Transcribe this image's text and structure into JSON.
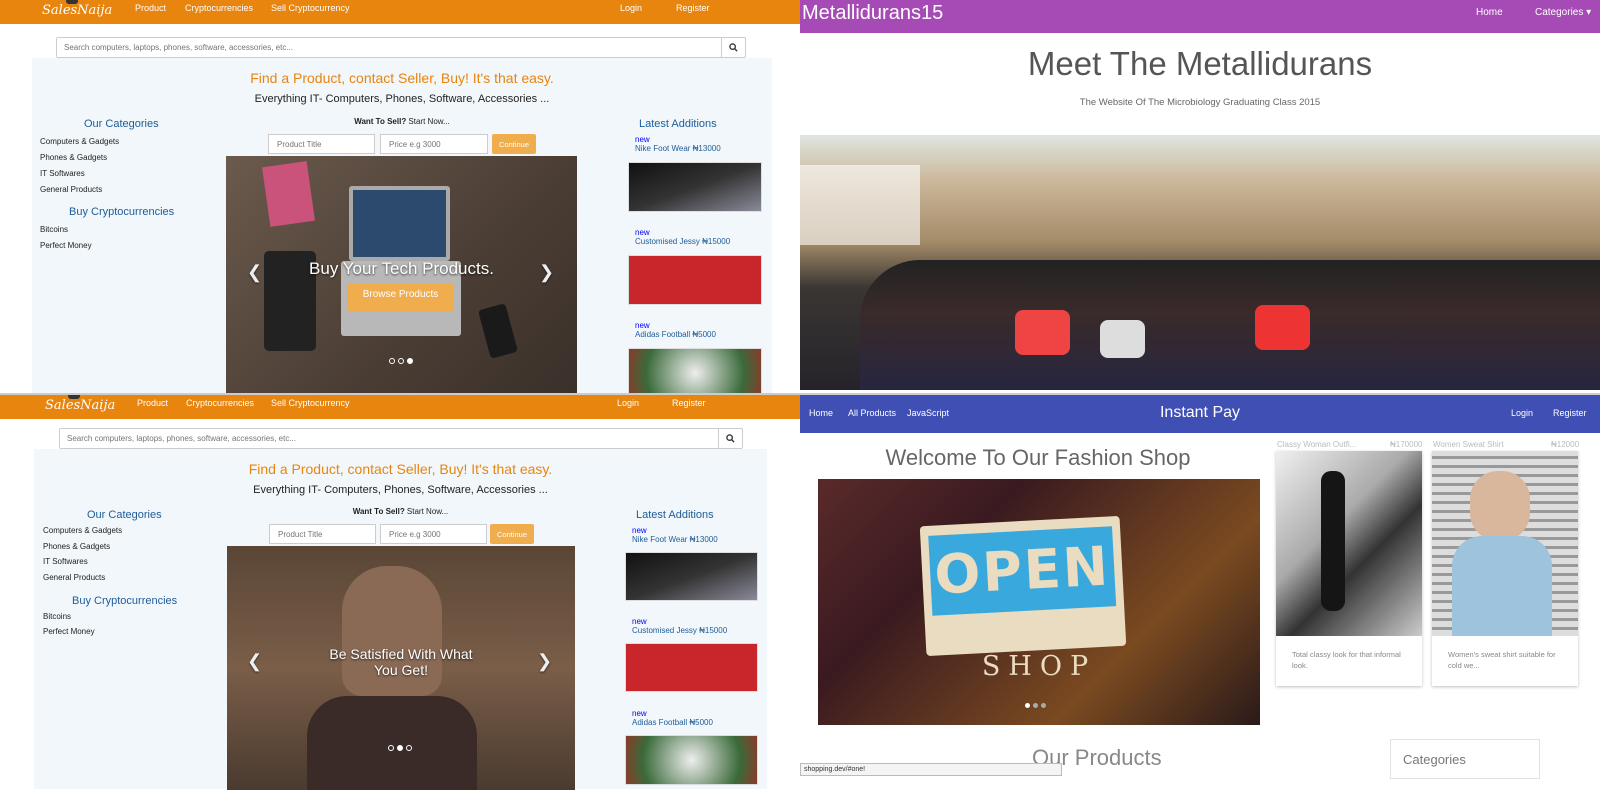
{
  "salesnaija": {
    "logo": "SalesNaija",
    "nav": {
      "product": "Product",
      "cryptocurrencies": "Cryptocurrencies",
      "sell_crypto": "Sell Cryptocurrency",
      "login": "Login",
      "register": "Register"
    },
    "search_placeholder": "Search computers, laptops, phones, software, accessories, etc...",
    "tagline": "Find a Product, contact Seller, Buy! It's that easy.",
    "subtag": "Everything IT- Computers, Phones, Software, Accessories ...",
    "categories_heading": "Our Categories",
    "categories": [
      "Computers & Gadgets",
      "Phones & Gadgets",
      "IT Softwares",
      "General Products"
    ],
    "crypto_heading": "Buy Cryptocurrencies",
    "crypto": [
      "Bitcoins",
      "Perfect Money"
    ],
    "want_bold": "Want To Sell?",
    "want_rest": " Start Now...",
    "title_placeholder": "Product Title",
    "price_placeholder": "Price e.g 3000",
    "continue": "Continue",
    "latest_heading": "Latest Additions",
    "latest": [
      {
        "badge": "new",
        "title": "Nike Foot Wear ₦13000"
      },
      {
        "badge": "new",
        "title": "Customised Jessy ₦15000"
      },
      {
        "badge": "new",
        "title": "Adidas Football ₦5000"
      }
    ],
    "slide_top": {
      "caption": "Buy Your Tech Products.",
      "button": "Browse Products",
      "active_dot": 3
    },
    "slide_bottom": {
      "caption": "Be Satisfied With What You Get!",
      "active_dot": 2
    }
  },
  "metallidurans": {
    "brand": "Metallidurans15",
    "nav": {
      "home": "Home",
      "categories": "Categories"
    },
    "title": "Meet The Metallidurans",
    "subtitle": "The Website Of The Microbiology Graduating Class 2015"
  },
  "instantpay": {
    "nav": {
      "home": "Home",
      "all_products": "All Products",
      "javascript": "JavaScript",
      "login": "Login",
      "register": "Register"
    },
    "brand": "Instant Pay",
    "welcome": "Welcome To Our Fashion Shop",
    "sign": {
      "open": "OPEN",
      "shop": "SHOP"
    },
    "cards": [
      {
        "title": "Classy Woman Outfi...",
        "price": "₦170000",
        "desc": "Total classy look for that informal look."
      },
      {
        "title": "Women Sweat Shirt",
        "price": "₦12000",
        "desc": "Women's sweat shirt suitable for cold we..."
      }
    ],
    "products_heading": "Our Products",
    "categories_box": "Categories",
    "status_url": "shopping.dev/#one!"
  }
}
